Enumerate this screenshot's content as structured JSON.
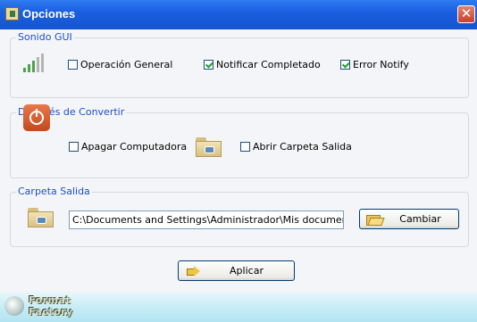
{
  "window": {
    "title": "Opciones",
    "close_symbol": "✕"
  },
  "groups": {
    "sonido": {
      "title": "Sonido GUI",
      "checkboxes": [
        {
          "label": "Operación General",
          "checked": false
        },
        {
          "label": "Notificar Completado",
          "checked": true
        },
        {
          "label": "Error Notify",
          "checked": true
        }
      ]
    },
    "despues": {
      "title": "Después de Convertir",
      "checkboxes": [
        {
          "label": "Apagar Computadora",
          "checked": false
        },
        {
          "label": "Abrir Carpeta Salida",
          "checked": false
        }
      ]
    },
    "carpeta": {
      "title": "Carpeta Salida",
      "path_value": "C:\\Documents and Settings\\Administrador\\Mis documentos\\FF",
      "change_button": "Cambiar"
    }
  },
  "apply_button": "Aplicar",
  "footer": {
    "logo_line1": "Format",
    "logo_line2": "Factory"
  },
  "icons": {
    "title": "app-icon",
    "volume": "signal-bars-icon",
    "power": "power-icon",
    "folder": "folder-icon",
    "open_folder": "open-folder-icon",
    "apply": "arrow-right-icon",
    "logo": "format-factory-logo-icon"
  },
  "colors": {
    "titlebar": "#1a5fe0",
    "group_title": "#1c4fce",
    "check": "#21a121",
    "footer": "#c5ecf6"
  }
}
